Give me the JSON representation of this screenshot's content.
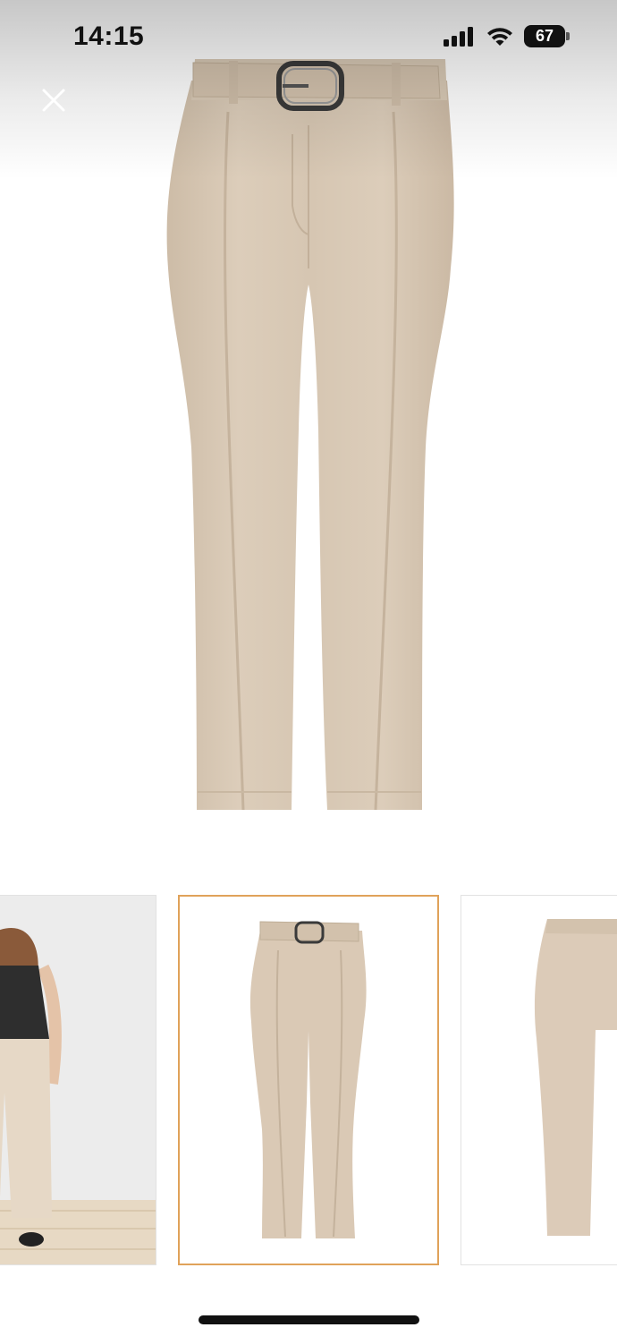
{
  "status_bar": {
    "time": "14:15",
    "battery_level": "67",
    "signal_icon": "cellular-signal-icon",
    "wifi_icon": "wifi-icon"
  },
  "close_button": {
    "icon": "close-icon"
  },
  "gallery": {
    "main_image": {
      "description_icon": "product-photo",
      "product_color": "#d8c9b6"
    },
    "thumbnails": [
      {
        "label": "model-back-view",
        "active": false
      },
      {
        "label": "product-front-view",
        "active": true
      },
      {
        "label": "product-back-view",
        "active": false
      }
    ],
    "active_index": 1,
    "accent_color": "#e0a25a"
  }
}
